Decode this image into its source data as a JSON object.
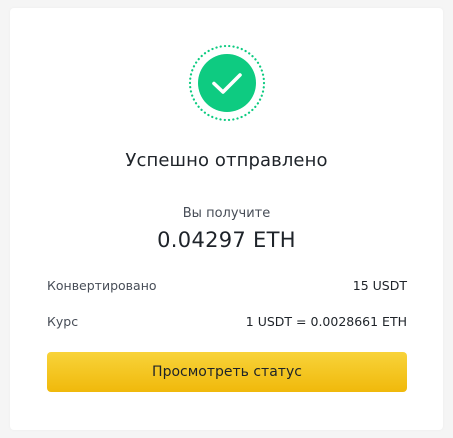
{
  "colors": {
    "success": "#0ecb81",
    "button": "#f0b90b",
    "text_primary": "#1e2329",
    "text_secondary": "#474d57"
  },
  "success_icon": "check-circle-icon",
  "title": "Успешно отправлено",
  "receive": {
    "label": "Вы получите",
    "amount": "0.04297 ETH"
  },
  "details": {
    "converted_label": "Конвертировано",
    "converted_value": "15 USDT",
    "rate_label": "Курс",
    "rate_value": "1 USDT = 0.0028661 ETH"
  },
  "actions": {
    "view_status_label": "Просмотреть статус"
  }
}
